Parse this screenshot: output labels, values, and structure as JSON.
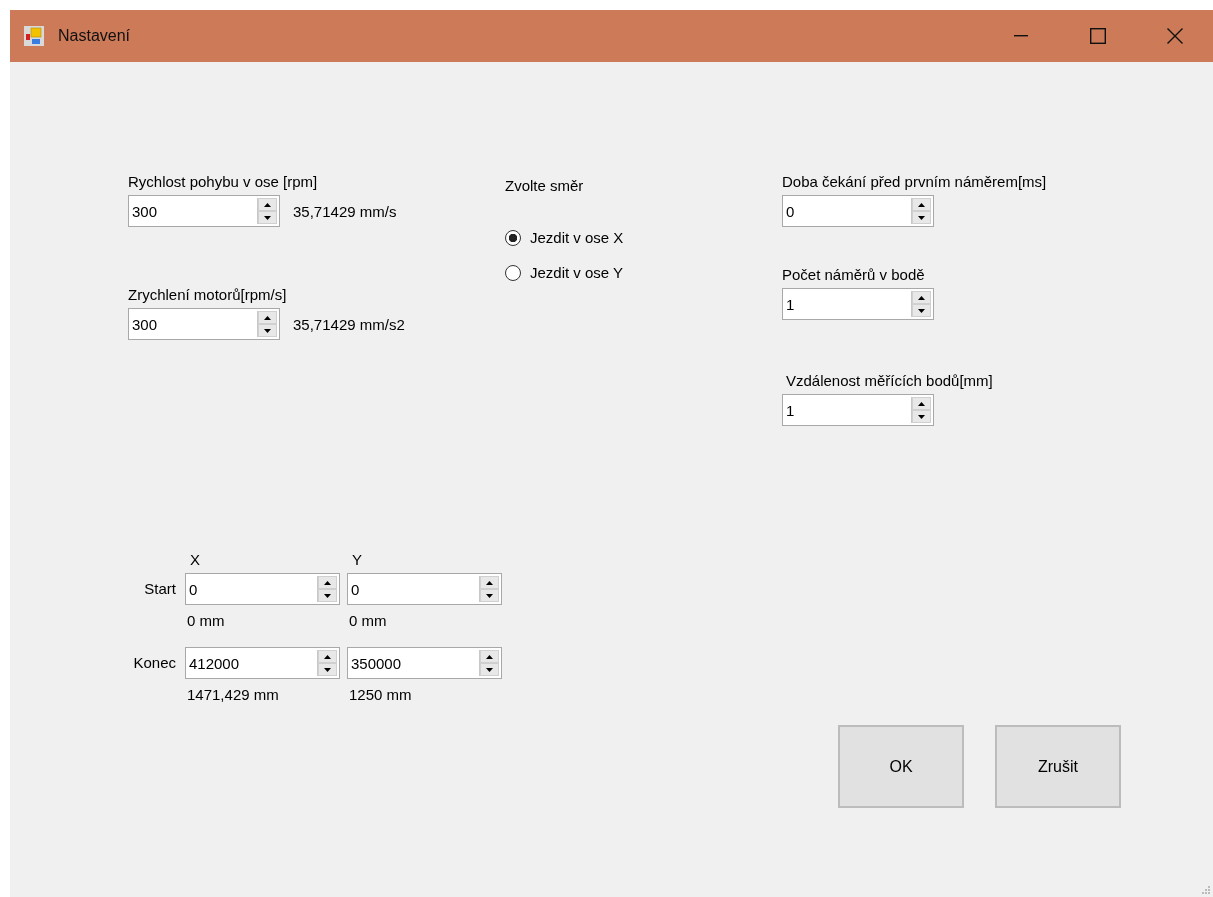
{
  "window": {
    "title": "Nastavení"
  },
  "speed": {
    "label": "Rychlost pohybu v ose [rpm]",
    "value": "300",
    "reading": "35,71429 mm/s"
  },
  "acceleration": {
    "label": "Zrychlení motorů[rpm/s]",
    "value": "300",
    "reading": "35,71429 mm/s2"
  },
  "direction": {
    "title": "Zvolte směr",
    "options": [
      {
        "label": "Jezdit v ose X",
        "selected": true
      },
      {
        "label": "Jezdit v ose Y",
        "selected": false
      }
    ]
  },
  "right_fields": [
    {
      "label": "Doba čekání před prvním náměrem[ms]",
      "value": "0"
    },
    {
      "label": "Počet náměrů v bodě",
      "value": "1"
    },
    {
      "label": "Vzdálenost měřících bodů[mm]",
      "value": "1"
    }
  ],
  "coordinates": {
    "columns": [
      "X",
      "Y"
    ],
    "rows": [
      {
        "label": "Start",
        "cells": [
          {
            "value": "0",
            "reading": "0 mm"
          },
          {
            "value": "0",
            "reading": "0 mm"
          }
        ]
      },
      {
        "label": "Konec",
        "cells": [
          {
            "value": "412000",
            "reading": "1471,429 mm"
          },
          {
            "value": "350000",
            "reading": "1250 mm"
          }
        ]
      }
    ]
  },
  "buttons": [
    "OK",
    "Zrušit"
  ]
}
